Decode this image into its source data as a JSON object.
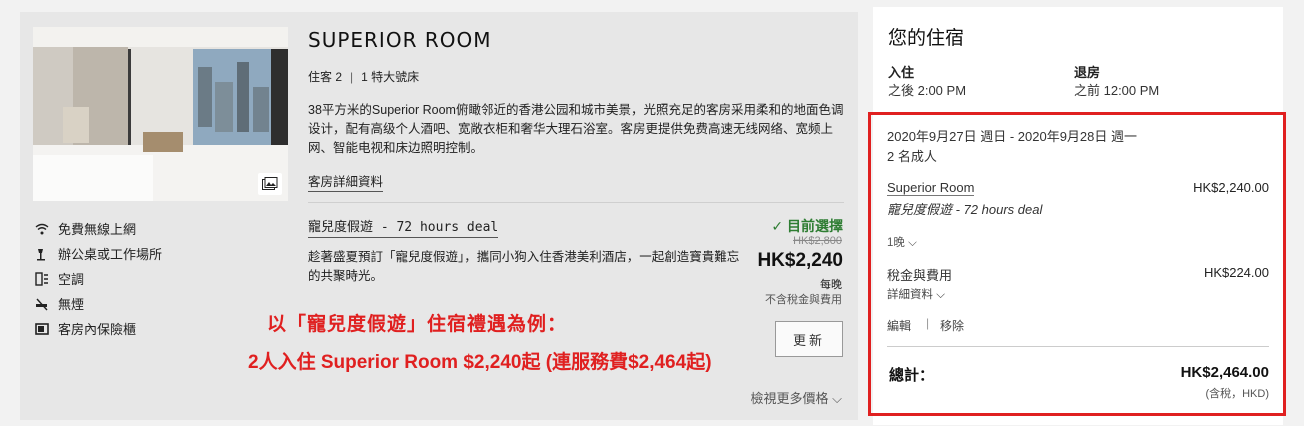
{
  "room": {
    "title": "SUPERIOR ROOM",
    "occupancy": "住客 2",
    "bed": "1 特大號床",
    "description": "38平方米的Superior Room俯瞰邻近的香港公园和城市美景，光照充足的客房采用柔和的地面色调设计，配有高级个人酒吧、宽敞衣柜和奢华大理石浴室。客房更提供免费高速无线网络、宽频上网、智能电视和床边照明控制。",
    "details_link": "客房詳細資料",
    "amenities": [
      {
        "icon": "wifi-icon",
        "label": "免費無線上網"
      },
      {
        "icon": "desk-lamp-icon",
        "label": "辦公桌或工作場所"
      },
      {
        "icon": "air-conditioning-icon",
        "label": "空調"
      },
      {
        "icon": "no-smoking-icon",
        "label": "無煙"
      },
      {
        "icon": "safe-icon",
        "label": "客房內保險櫃"
      }
    ]
  },
  "rate": {
    "name": "寵兒度假遊 - 72 hours deal",
    "description": "趁著盛夏預訂「寵兒度假遊」，攜同小狗入住香港美利酒店，一起創造寶貴難忘的共聚時光。",
    "selected_label": "✓ 目前選擇",
    "original_price": "HK$2,800",
    "price": "HK$2,240",
    "per_night": "每晚",
    "excl_note": "不含稅金與費用",
    "update_button": "更新",
    "more_prices": "檢視更多價格 ⌵"
  },
  "promo": {
    "line1": "以「寵兒度假遊」住宿禮遇為例：",
    "line2": "2人入住 Superior Room $2,240起 (連服務費$2,464起)"
  },
  "summary": {
    "title": "您的住宿",
    "checkin_label": "入住",
    "checkin_time": "之後 2:00 PM",
    "checkout_label": "退房",
    "checkout_time": "之前 12:00 PM",
    "dates": "2020年9月27日 週日 - 2020年9月28日 週一",
    "guests": "2 名成人",
    "room_name": "Superior Room",
    "room_price": "HK$2,240.00",
    "rate_name": "寵兒度假遊 - 72 hours deal",
    "nights": "1晚 ⌵",
    "tax_label": "稅金與費用",
    "tax_price": "HK$224.00",
    "tax_details": "詳細資料 ⌵",
    "edit": "編輯",
    "separator": "|",
    "remove": "移除",
    "total_label": "總計：",
    "total_price": "HK$2,464.00",
    "total_note": "(含稅，HKD)"
  },
  "colors": {
    "accent_green": "#2e7d32",
    "highlight_red": "#e02020"
  }
}
